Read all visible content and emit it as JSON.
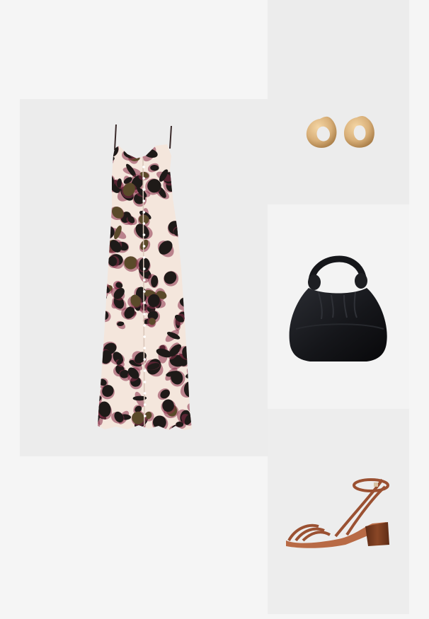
{
  "collage": {
    "items": [
      {
        "id": "dress",
        "label": "",
        "print_colors": [
          "#f4e6dc",
          "#1e1a18",
          "#8a2f4a",
          "#5a4a2a"
        ]
      },
      {
        "id": "earrings",
        "label": "",
        "metal_color": "#d9b079"
      },
      {
        "id": "bag",
        "label": "",
        "color": "#15161a"
      },
      {
        "id": "sandal",
        "label": "",
        "color": "#9b5132",
        "heel_color": "#7a3a1e"
      }
    ]
  }
}
